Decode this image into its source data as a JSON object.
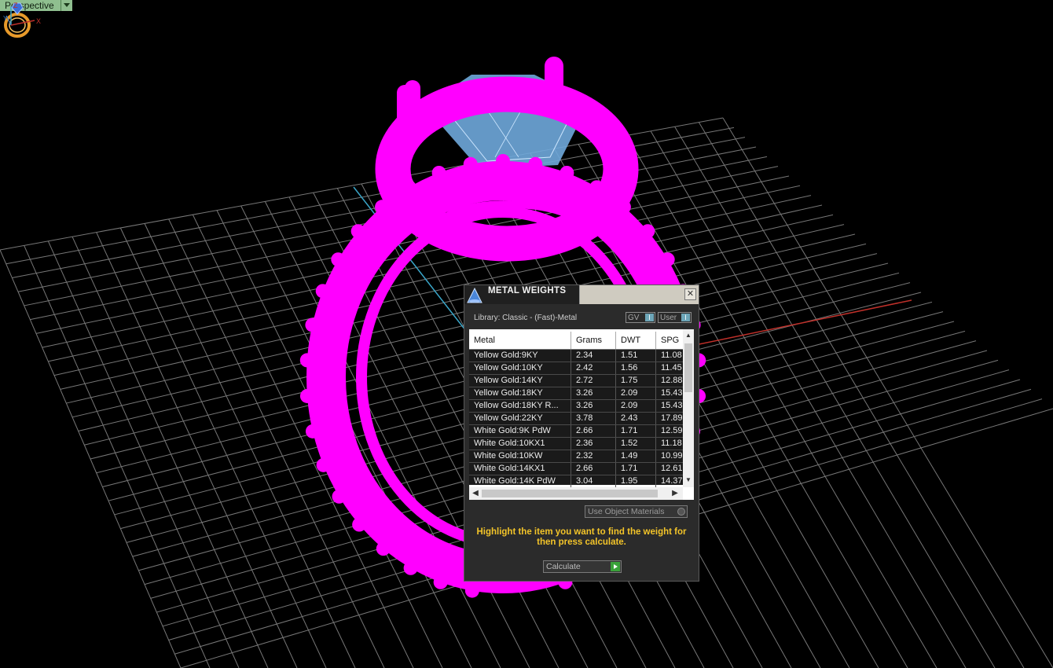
{
  "viewport": {
    "label": "Perspective",
    "colors": {
      "grid": "#777777",
      "ring": "#ff00ff",
      "stone": "#7ab8ff",
      "x_axis": "#c0302a",
      "y_axis": "#3aa6c9"
    }
  },
  "axes": {
    "z": "Z",
    "y": "Y",
    "x": "X"
  },
  "dialog": {
    "title": "METAL WEIGHTS",
    "library": "Library: Classic - (Fast)-Metal",
    "gv_label": "GV",
    "user_label": "User",
    "toggle_glyph": "I",
    "close_glyph": "✕",
    "table": {
      "columns": [
        "Metal",
        "Grams",
        "DWT",
        "SPG"
      ],
      "rows": [
        [
          "Yellow Gold:9KY",
          "2.34",
          "1.51",
          "11.08"
        ],
        [
          "Yellow Gold:10KY",
          "2.42",
          "1.56",
          "11.45"
        ],
        [
          "Yellow Gold:14KY",
          "2.72",
          "1.75",
          "12.88"
        ],
        [
          "Yellow Gold:18KY",
          "3.26",
          "2.09",
          "15.43"
        ],
        [
          "Yellow Gold:18KY R...",
          "3.26",
          "2.09",
          "15.43"
        ],
        [
          "Yellow Gold:22KY",
          "3.78",
          "2.43",
          "17.89"
        ],
        [
          "White Gold:9K PdW",
          "2.66",
          "1.71",
          "12.59"
        ],
        [
          "White Gold:10KX1",
          "2.36",
          "1.52",
          "11.18"
        ],
        [
          "White Gold:10KW",
          "2.32",
          "1.49",
          "10.99"
        ],
        [
          "White Gold:14KX1",
          "2.66",
          "1.71",
          "12.61"
        ],
        [
          "White Gold:14K PdW",
          "3.04",
          "1.95",
          "14.37"
        ]
      ]
    },
    "use_object_materials": "Use Object Materials",
    "hint": "Highlight the item you want to find the weight for then press calculate.",
    "calculate": "Calculate"
  }
}
